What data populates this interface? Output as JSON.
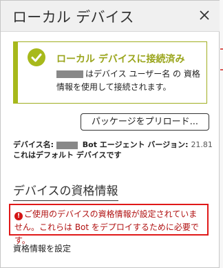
{
  "header": {
    "title": "ローカル デバイス",
    "close_icon": "close-icon"
  },
  "status": {
    "title": "ローカル デバイスに接続済み",
    "body": "はデバイス ユーザー名 の 資格情報を使用して接続されます。",
    "accent_color": "#a7b91b",
    "icon": "check-circle-icon"
  },
  "actions": {
    "preload_label": "パッケージをプリロード..."
  },
  "device": {
    "name_label": "デバイス名:",
    "bot_agent_label": "Bot エージェント バージョン:",
    "version": "21.81",
    "default_text": "これはデフォルト デバイスです"
  },
  "credentials": {
    "section_title": "デバイスの資格情報",
    "error_text": "ご使用のデバイスの資格情報が設定されていません。これらは Bot をデプロイするために必要です。",
    "error_color": "#e01818",
    "setup_link": "資格情報を設定"
  }
}
